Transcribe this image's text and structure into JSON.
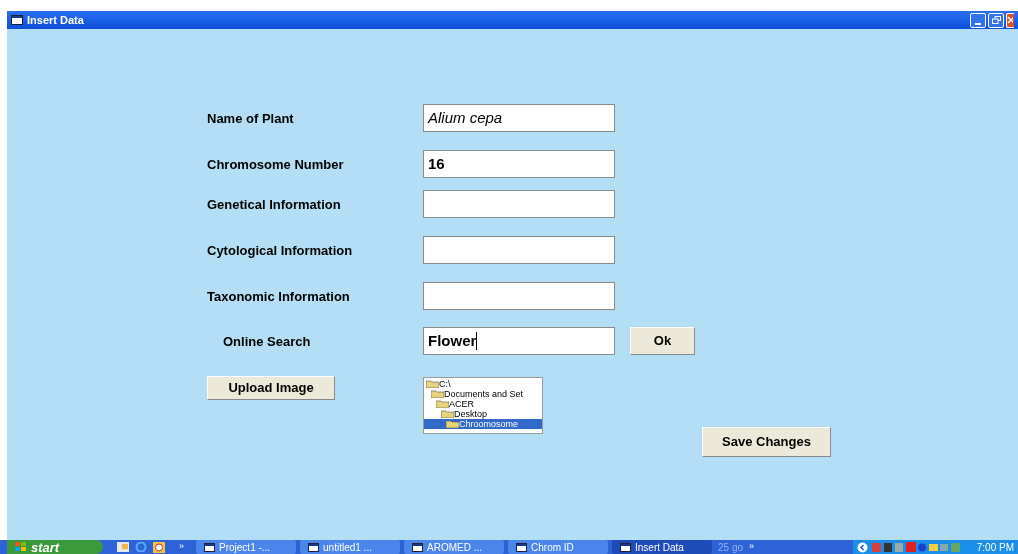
{
  "window": {
    "title": "Insert Data"
  },
  "fields": [
    {
      "label": "Name of Plant",
      "value": "Alium cepa"
    },
    {
      "label": "Chromosome Number",
      "value": "16"
    },
    {
      "label": "Genetical Information"
    },
    {
      "label": "Cytological Information"
    },
    {
      "label": "Taxonomic Information"
    },
    {
      "label": "Online Search",
      "value": "Flower"
    }
  ],
  "ok_button": "Ok",
  "upload_button": "Upload Image",
  "folders": [
    {
      "name": "C:\\",
      "selected": false,
      "children": [
        {
          "name": "Documents and Set",
          "selected": false,
          "children": [
            {
              "name": "ACER",
              "selected": false,
              "children": [
                {
                  "name": "Desktop",
                  "selected": false,
                  "children": [
                    {
                      "name": "Chroomosome",
                      "selected": true
                    }
                  ]
                }
              ]
            }
          ]
        }
      ]
    }
  ],
  "save_button": "Save Changes",
  "taskbar": {
    "start": "start",
    "quick_launch_more": "»",
    "tasks": [
      {
        "label": "Project1 -...",
        "selected": false
      },
      {
        "label": "untitled1 ...",
        "selected": false
      },
      {
        "label": "AROMED ...",
        "selected": false
      },
      {
        "label": "Chrom ID",
        "selected": false
      },
      {
        "label": "Insert Data",
        "selected": true
      }
    ],
    "address": "25 go",
    "tray_more": "»",
    "clock": "7:00 PM"
  }
}
